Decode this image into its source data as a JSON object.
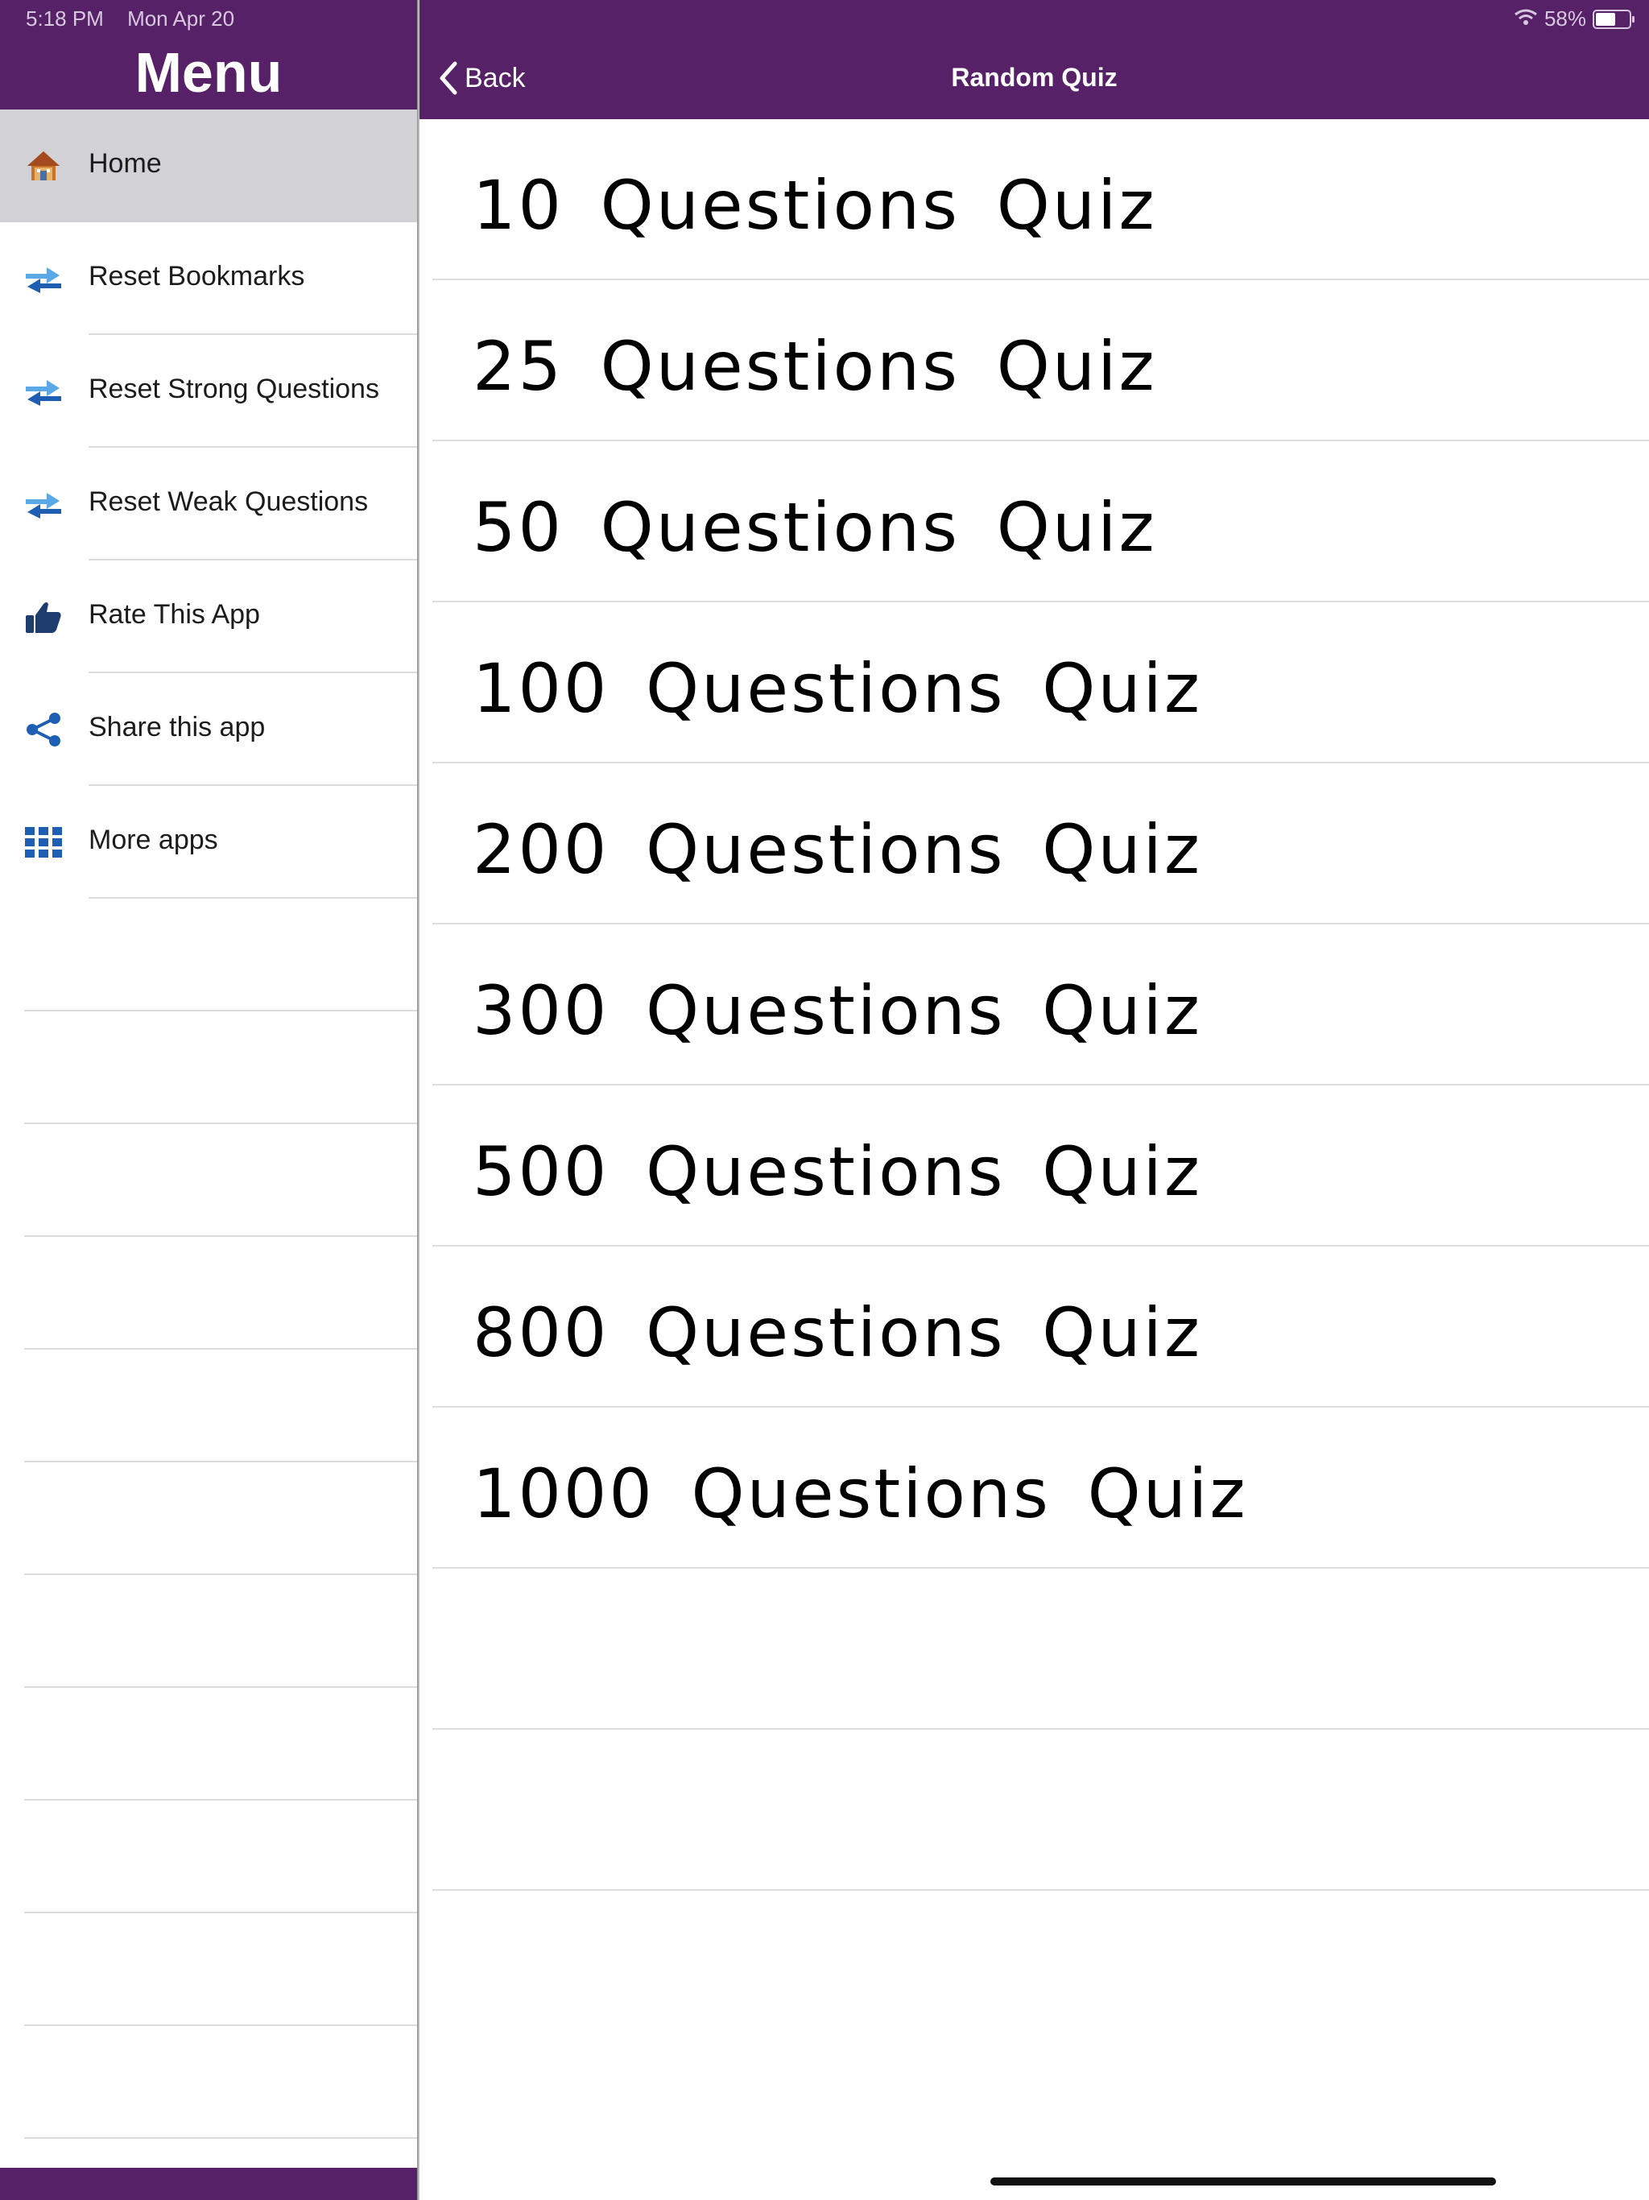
{
  "status_bar": {
    "time": "5:18 PM",
    "date": "Mon Apr 20",
    "battery": "58%"
  },
  "sidebar": {
    "title": "Menu",
    "items": [
      {
        "label": "Home",
        "icon": "house-icon",
        "selected": true
      },
      {
        "label": "Reset Bookmarks",
        "icon": "reset-arrows-icon"
      },
      {
        "label": "Reset Strong Questions",
        "icon": "reset-arrows-icon"
      },
      {
        "label": "Reset Weak Questions",
        "icon": "reset-arrows-icon"
      },
      {
        "label": "Rate This App",
        "icon": "thumbs-up-icon"
      },
      {
        "label": "Share this app",
        "icon": "share-icon"
      },
      {
        "label": "More apps",
        "icon": "grid-icon"
      }
    ]
  },
  "navbar": {
    "back_label": "Back",
    "title": "Random Quiz"
  },
  "quizzes": [
    "10 Questions Quiz",
    "25 Questions Quiz",
    "50 Questions Quiz",
    "100 Questions Quiz",
    "200 Questions Quiz",
    "300 Questions Quiz",
    "500 Questions Quiz",
    "800 Questions Quiz",
    "1000 Questions Quiz"
  ],
  "colors": {
    "brand": "#562166",
    "selected_row": "#d2d1d6",
    "icon_blue": "#1e5fb4"
  }
}
